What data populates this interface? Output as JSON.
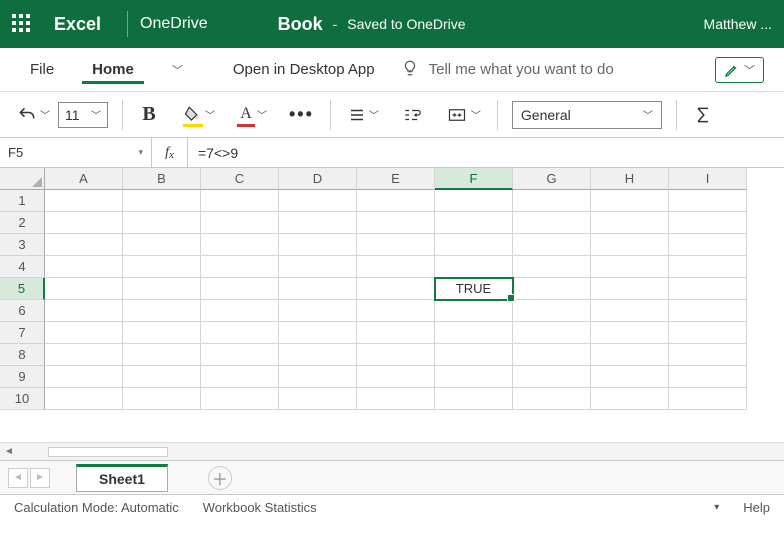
{
  "titlebar": {
    "app": "Excel",
    "drive": "OneDrive",
    "doc": "Book",
    "saved": "Saved to OneDrive",
    "user": "Matthew ..."
  },
  "menu": {
    "file": "File",
    "home": "Home",
    "open_desktop": "Open in Desktop App",
    "tellme": "Tell me what you want to do"
  },
  "ribbon": {
    "fontsize": "11",
    "numfmt": "General"
  },
  "fbar": {
    "namebox": "F5",
    "formula": "=7<>9"
  },
  "grid": {
    "cols": [
      "A",
      "B",
      "C",
      "D",
      "E",
      "F",
      "G",
      "H",
      "I"
    ],
    "rows": [
      "1",
      "2",
      "3",
      "4",
      "5",
      "6",
      "7",
      "8",
      "9",
      "10"
    ],
    "selectedCol": "F",
    "selectedRow": "5",
    "cellValue": "TRUE"
  },
  "sheets": {
    "active": "Sheet1"
  },
  "status": {
    "calc": "Calculation Mode: Automatic",
    "wb": "Workbook Statistics",
    "help": "Help"
  }
}
